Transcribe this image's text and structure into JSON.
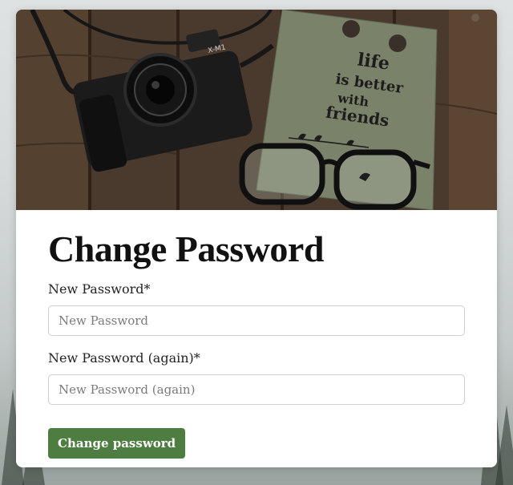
{
  "form": {
    "title": "Change Password",
    "fields": [
      {
        "label": "New Password*",
        "placeholder": "New Password",
        "value": ""
      },
      {
        "label": "New Password (again)*",
        "placeholder": "New Password (again)",
        "value": ""
      }
    ],
    "submit_label": "Change password"
  },
  "hero": {
    "camera_brand": "X-M1",
    "notebook_text": [
      "life",
      "is better",
      "with",
      "friends"
    ]
  },
  "colors": {
    "accent": "#4e7d42",
    "card_bg": "#ffffff",
    "wood": "#4a3a2e",
    "notebook": "#7b826a"
  }
}
